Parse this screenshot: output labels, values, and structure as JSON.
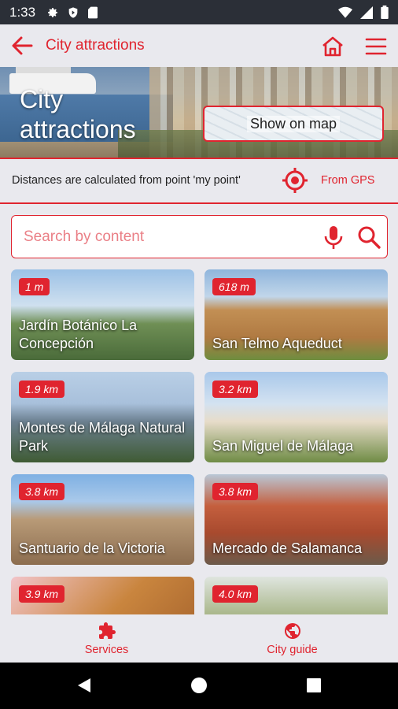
{
  "status_bar": {
    "time": "1:33"
  },
  "app_bar": {
    "title": "City attractions"
  },
  "hero": {
    "title_line1": "City",
    "title_line2": "attractions",
    "map_button_label": "Show on map"
  },
  "distance_info": {
    "text": "Distances are calculated from point 'my point'",
    "gps_label": "From GPS"
  },
  "search": {
    "placeholder": "Search by content"
  },
  "attractions": [
    {
      "distance": "1 m",
      "name": "Jardín Botánico La Concepción"
    },
    {
      "distance": "618 m",
      "name": "San Telmo Aqueduct"
    },
    {
      "distance": "1.9 km",
      "name": "Montes de Málaga Natural Park"
    },
    {
      "distance": "3.2 km",
      "name": "San Miguel de Málaga"
    },
    {
      "distance": "3.8 km",
      "name": "Santuario de la Victoria"
    },
    {
      "distance": "3.8 km",
      "name": "Mercado de Salamanca"
    },
    {
      "distance": "3.9 km",
      "name": ""
    },
    {
      "distance": "4.0 km",
      "name": ""
    }
  ],
  "bottom_nav": [
    {
      "label": "Services",
      "icon": "puzzle-icon"
    },
    {
      "label": "City guide",
      "icon": "globe-icon"
    }
  ],
  "colors": {
    "accent": "#e0242f",
    "background": "#e9e9ee",
    "status_bar": "#2b2f37"
  }
}
